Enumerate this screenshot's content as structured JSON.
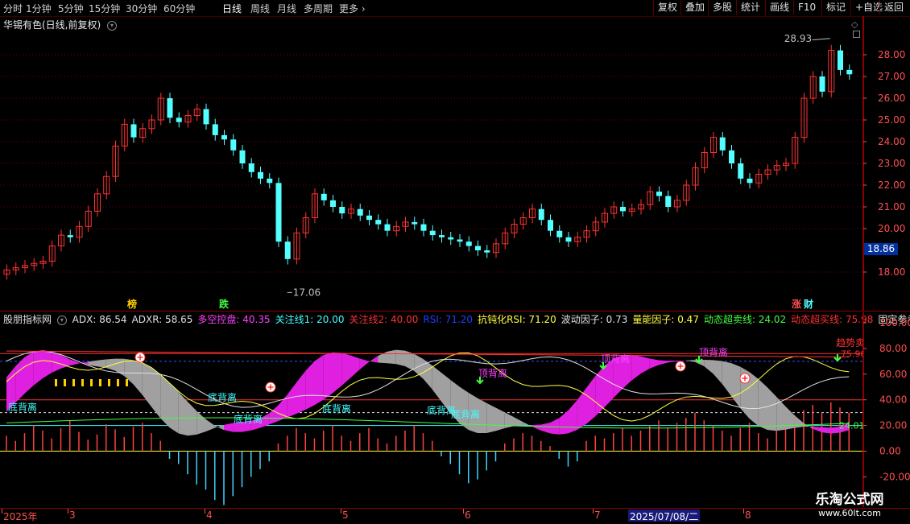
{
  "toolbar": {
    "periods": [
      "分时",
      "1分钟",
      "5分钟",
      "15分钟",
      "30分钟",
      "60分钟",
      "日线",
      "周线",
      "月线",
      "多周期",
      "更多"
    ],
    "active_period": "日线",
    "right_buttons": [
      "复权",
      "叠加",
      "多股",
      "统计",
      "画线",
      "F10",
      "标记",
      "+自选",
      "返回"
    ]
  },
  "stock": {
    "title": "华锡有色(日线,前复权)"
  },
  "price_axis": {
    "labels": [
      "28.00",
      "27.00",
      "26.00",
      "25.00",
      "24.00",
      "23.00",
      "22.00",
      "21.00",
      "20.00",
      "18.00"
    ],
    "current_price": "18.86"
  },
  "annotations": {
    "high_label": "28.93",
    "low_label": "17.06",
    "tag_bang": "榜",
    "tag_die": "跌",
    "tag_zhang": "涨",
    "tag_cai": "财"
  },
  "indicator": {
    "name": "股朋指标网",
    "items": [
      {
        "label": "ADX: 86.54",
        "color": "#e0e0e0"
      },
      {
        "label": "ADXR: 58.65",
        "color": "#e0e0e0"
      },
      {
        "label": "多空控盘: 40.35",
        "color": "#ff40ff"
      },
      {
        "label": "关注线1: 20.00",
        "color": "#40ffff"
      },
      {
        "label": "关注线2: 40.00",
        "color": "#ff3030"
      },
      {
        "label": "RSI: 71.20",
        "color": "#2040ff"
      },
      {
        "label": "抗钝化RSI: 71.20",
        "color": "#ffff40"
      },
      {
        "label": "波动因子: 0.73",
        "color": "#e0e0e0"
      },
      {
        "label": "量能因子: 0.47",
        "color": "#ffff40"
      },
      {
        "label": "动态超卖线: 24.02",
        "color": "#40ff40"
      },
      {
        "label": "动态超买线: 75.98",
        "color": "#ff3030"
      },
      {
        "label": "固定参考线",
        "color": "#e0e0e0"
      }
    ],
    "axis_labels": [
      "100.00",
      "80.00",
      "60.00",
      "40.00",
      "20.00",
      "0.00",
      "-20.00"
    ],
    "right_values": {
      "overbought": "75.98",
      "oversold": "24.01"
    },
    "signals": {
      "bottom_div": "底背离",
      "top_div": "顶背离",
      "trend_sell": "趋势卖"
    }
  },
  "dates": {
    "labels": [
      "2025年",
      "3",
      "4",
      "5",
      "6",
      "7",
      "8"
    ],
    "highlight": "2025/07/08/二"
  },
  "watermark": {
    "line1": "乐淘公式网",
    "line2": "www.60lt.com"
  },
  "chart_data": {
    "type": "candlestick",
    "title": "华锡有色(日线,前复权)",
    "ylim": [
      17.06,
      28.93
    ],
    "high": 28.93,
    "low": 17.06,
    "last": 18.86,
    "closes": [
      18.1,
      18.2,
      18.3,
      18.4,
      18.5,
      19.2,
      19.7,
      19.6,
      20.1,
      20.8,
      21.6,
      22.4,
      23.8,
      24.8,
      24.2,
      24.6,
      25.0,
      26.0,
      25.1,
      24.9,
      25.2,
      25.5,
      24.8,
      24.3,
      24.1,
      23.6,
      23.0,
      22.6,
      22.3,
      22.1,
      19.4,
      18.6,
      19.8,
      20.5,
      21.6,
      21.3,
      21.0,
      20.7,
      20.9,
      20.6,
      20.4,
      20.2,
      19.9,
      20.1,
      20.3,
      20.2,
      19.9,
      19.7,
      19.6,
      19.5,
      19.4,
      19.2,
      19.0,
      18.9,
      19.3,
      19.8,
      20.2,
      20.5,
      20.9,
      20.4,
      19.9,
      19.6,
      19.4,
      19.6,
      19.9,
      20.3,
      20.7,
      21.0,
      20.8,
      20.9,
      21.1,
      21.7,
      21.5,
      21.0,
      21.3,
      22.0,
      22.8,
      23.5,
      24.2,
      23.6,
      23.0,
      22.3,
      22.1,
      22.5,
      22.7,
      22.9,
      23.0,
      24.2,
      26.0,
      27.0,
      26.3,
      28.2,
      27.3,
      27.1
    ]
  }
}
